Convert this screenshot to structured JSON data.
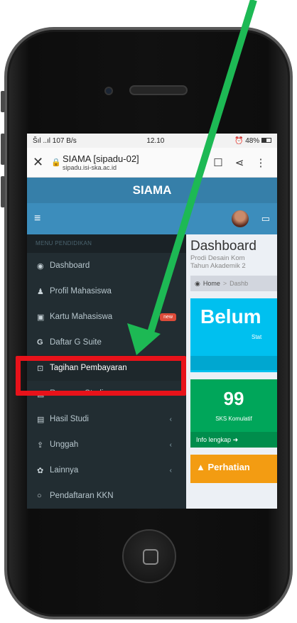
{
  "status_bar": {
    "signal": "Šıl ..ıl 107 B/s",
    "time": "12.10",
    "battery": "48%"
  },
  "address_bar": {
    "title": "SIAMA [sipadu-02]",
    "url": "sipadu.isi-ska.ac.id"
  },
  "app": {
    "title": "SIAMA"
  },
  "sidebar": {
    "header": "MENU PENDIDIKAN",
    "items": [
      {
        "icon": "dashboard-icon",
        "label": "Dashboard"
      },
      {
        "icon": "user-icon",
        "label": "Profil Mahasiswa"
      },
      {
        "icon": "id-card-icon",
        "label": "Kartu Mahasiswa",
        "badge": "new"
      },
      {
        "icon": "google-icon",
        "label": "Daftar G Suite"
      },
      {
        "icon": "money-icon",
        "label": "Tagihan Pembayaran"
      },
      {
        "icon": "file-icon",
        "label": "Rencana Studi"
      },
      {
        "icon": "file-icon",
        "label": "Hasil Studi"
      },
      {
        "icon": "upload-icon",
        "label": "Unggah"
      },
      {
        "icon": "gear-icon",
        "label": "Lainnya"
      },
      {
        "icon": "circle-icon",
        "label": "Pendaftaran KKN"
      }
    ]
  },
  "content": {
    "title": "Dashboard",
    "subtitle_1": "Prodi Desain Kom",
    "subtitle_2": "Tahun Akademik 2",
    "breadcrumb_home": "Home",
    "breadcrumb_current": "Dashb",
    "aqua_box": {
      "big_text": "Belum",
      "small_text": "Stat"
    },
    "green_box": {
      "number": "99",
      "label": "SKS Komulatif",
      "footer": "Info lengkap"
    },
    "warning_box": {
      "text": "Perhatian"
    }
  },
  "annotation": {
    "arrow_color": "#1db954",
    "highlight_color": "#e8121a"
  }
}
